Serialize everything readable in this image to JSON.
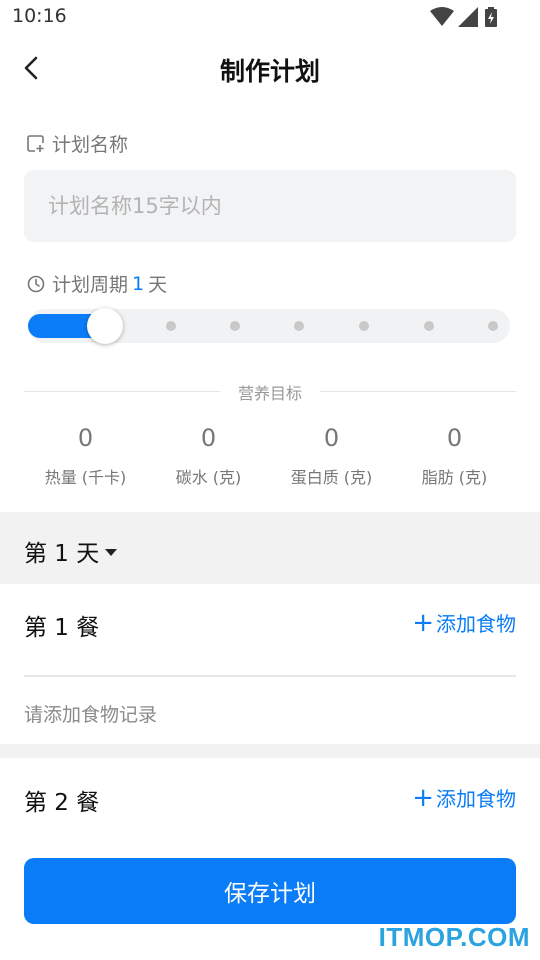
{
  "status_bar": {
    "time": "10:16",
    "icons": [
      "wifi-icon",
      "signal-icon",
      "battery-charging-icon"
    ]
  },
  "header": {
    "title": "制作计划",
    "back_icon": "chevron-left-icon"
  },
  "plan_name": {
    "label": "计划名称",
    "icon": "edit-note-icon",
    "placeholder": "计划名称15字以内",
    "value": ""
  },
  "plan_cycle": {
    "label": "计划周期",
    "icon": "clock-icon",
    "value": "1",
    "unit": "天",
    "slider": {
      "level": 1,
      "steps": 7
    }
  },
  "nutrition": {
    "heading": "营养目标",
    "items": [
      {
        "value": "0",
        "label": "热量 (千卡)"
      },
      {
        "value": "0",
        "label": "碳水 (克)"
      },
      {
        "value": "0",
        "label": "蛋白质 (克)"
      },
      {
        "value": "0",
        "label": "脂肪 (克)"
      }
    ]
  },
  "day_selector": {
    "label": "第 1 天"
  },
  "meals": [
    {
      "name": "第 1 餐",
      "add_label": "添加食物",
      "empty_text": "请添加食物记录"
    },
    {
      "name": "第 2 餐",
      "add_label": "添加食物"
    }
  ],
  "save_button": {
    "label": "保存计划"
  },
  "watermark": "ITMOP.COM",
  "colors": {
    "accent": "#0a7cf7",
    "section_bg": "#f2f2f2",
    "input_bg": "#f2f3f5"
  }
}
